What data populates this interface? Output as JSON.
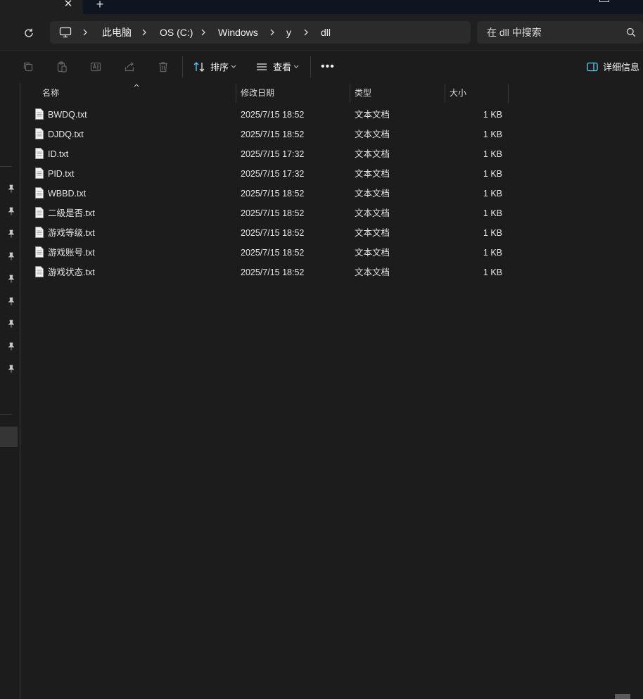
{
  "tab": {
    "close_glyph": "✕",
    "new_glyph": "+"
  },
  "breadcrumb": [
    "此电脑",
    "OS (C:)",
    "Windows",
    "y",
    "dll"
  ],
  "search": {
    "placeholder": "在 dll 中搜索"
  },
  "toolbar": {
    "sort_label": "排序",
    "view_label": "查看",
    "more_label": "•••",
    "details_label": "详细信息"
  },
  "columns": {
    "name": "名称",
    "date": "修改日期",
    "type": "类型",
    "size": "大小"
  },
  "files": [
    {
      "name": "BWDQ.txt",
      "date": "2025/7/15 18:52",
      "type": "文本文档",
      "size": "1 KB"
    },
    {
      "name": "DJDQ.txt",
      "date": "2025/7/15 18:52",
      "type": "文本文档",
      "size": "1 KB"
    },
    {
      "name": "ID.txt",
      "date": "2025/7/15 17:32",
      "type": "文本文档",
      "size": "1 KB"
    },
    {
      "name": "PID.txt",
      "date": "2025/7/15 17:32",
      "type": "文本文档",
      "size": "1 KB"
    },
    {
      "name": "WBBD.txt",
      "date": "2025/7/15 18:52",
      "type": "文本文档",
      "size": "1 KB"
    },
    {
      "name": "二级是否.txt",
      "date": "2025/7/15 18:52",
      "type": "文本文档",
      "size": "1 KB"
    },
    {
      "name": "游戏等级.txt",
      "date": "2025/7/15 18:52",
      "type": "文本文档",
      "size": "1 KB"
    },
    {
      "name": "游戏账号.txt",
      "date": "2025/7/15 18:52",
      "type": "文本文档",
      "size": "1 KB"
    },
    {
      "name": "游戏状态.txt",
      "date": "2025/7/15 18:52",
      "type": "文本文档",
      "size": "1 KB"
    }
  ],
  "colors": {
    "background": "#1c1c1c",
    "address_bg": "#2b2b2b",
    "titlebar": "#0e1420",
    "accent": "#60cdff"
  }
}
